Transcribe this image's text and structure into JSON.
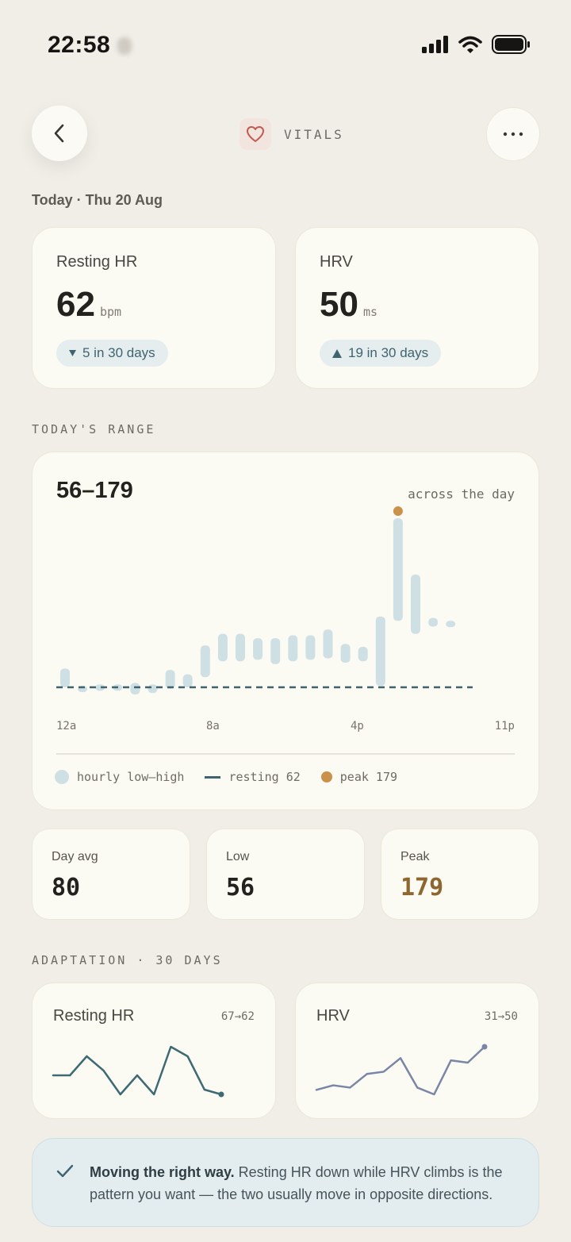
{
  "status_bar": {
    "time": "22:58"
  },
  "header": {
    "title": "VITALS",
    "back_icon": "chevron-left-icon",
    "more_icon": "ellipsis-icon",
    "app_icon": "heart-icon"
  },
  "date_label": "Today · Thu 20 Aug",
  "metrics": [
    {
      "label": "Resting HR",
      "value": "62",
      "unit": "bpm",
      "trend": "5 in 30 days",
      "trend_direction": "down"
    },
    {
      "label": "HRV",
      "value": "50",
      "unit": "ms",
      "trend": "19 in 30 days",
      "trend_direction": "up"
    }
  ],
  "range_section": {
    "title": "TODAY'S RANGE",
    "range": "56–179",
    "subtitle": "across the day",
    "ticks": [
      "12a",
      "8a",
      "4p",
      "11p"
    ],
    "legend": {
      "hourly": "hourly low–high",
      "resting": "resting 62",
      "peak": "peak 179"
    },
    "colors": {
      "bar": "#cfe0e5",
      "resting": "#3f6470",
      "peak": "#c9914a"
    }
  },
  "chart_data": {
    "type": "bar",
    "title": "56–179",
    "subtitle": "across the day",
    "x_ticks": [
      "12a",
      "8a",
      "4p",
      "11p"
    ],
    "resting": 62,
    "peak": 179,
    "series": [
      {
        "name": "hourly low–high",
        "ranges": [
          [
            62,
            75
          ],
          [
            60,
            63
          ],
          [
            60,
            64
          ],
          [
            61,
            64
          ],
          [
            57,
            65
          ],
          [
            58,
            64
          ],
          [
            61,
            74
          ],
          [
            62,
            71
          ],
          [
            69,
            91
          ],
          [
            80,
            99
          ],
          [
            80,
            99
          ],
          [
            81,
            96
          ],
          [
            78,
            96
          ],
          [
            80,
            98
          ],
          [
            81,
            98
          ],
          [
            82,
            102
          ],
          [
            79,
            92
          ],
          [
            80,
            90
          ],
          [
            63,
            111
          ],
          [
            108,
            179
          ],
          [
            99,
            140
          ],
          [
            104,
            110
          ],
          [
            105,
            108
          ]
        ]
      }
    ]
  },
  "stats": [
    {
      "label": "Day avg",
      "value": "80"
    },
    {
      "label": "Low",
      "value": "56"
    },
    {
      "label": "Peak",
      "value": "179"
    }
  ],
  "adaptation": {
    "title": "ADAPTATION · 30 DAYS",
    "cards": [
      {
        "label": "Resting HR",
        "delta": "67→62",
        "color": "#3d6a73",
        "values": [
          66,
          66,
          70,
          67,
          62,
          66,
          62,
          72,
          70,
          63,
          62
        ]
      },
      {
        "label": "HRV",
        "delta": "31→50",
        "color": "#7a86a6",
        "values": [
          31,
          33,
          32,
          38,
          39,
          45,
          32,
          29,
          44,
          43,
          50
        ]
      }
    ]
  },
  "note": {
    "bold": "Moving the right way.",
    "text": " Resting HR down while HRV climbs is the pattern you want — the two usually move in opposite directions."
  }
}
